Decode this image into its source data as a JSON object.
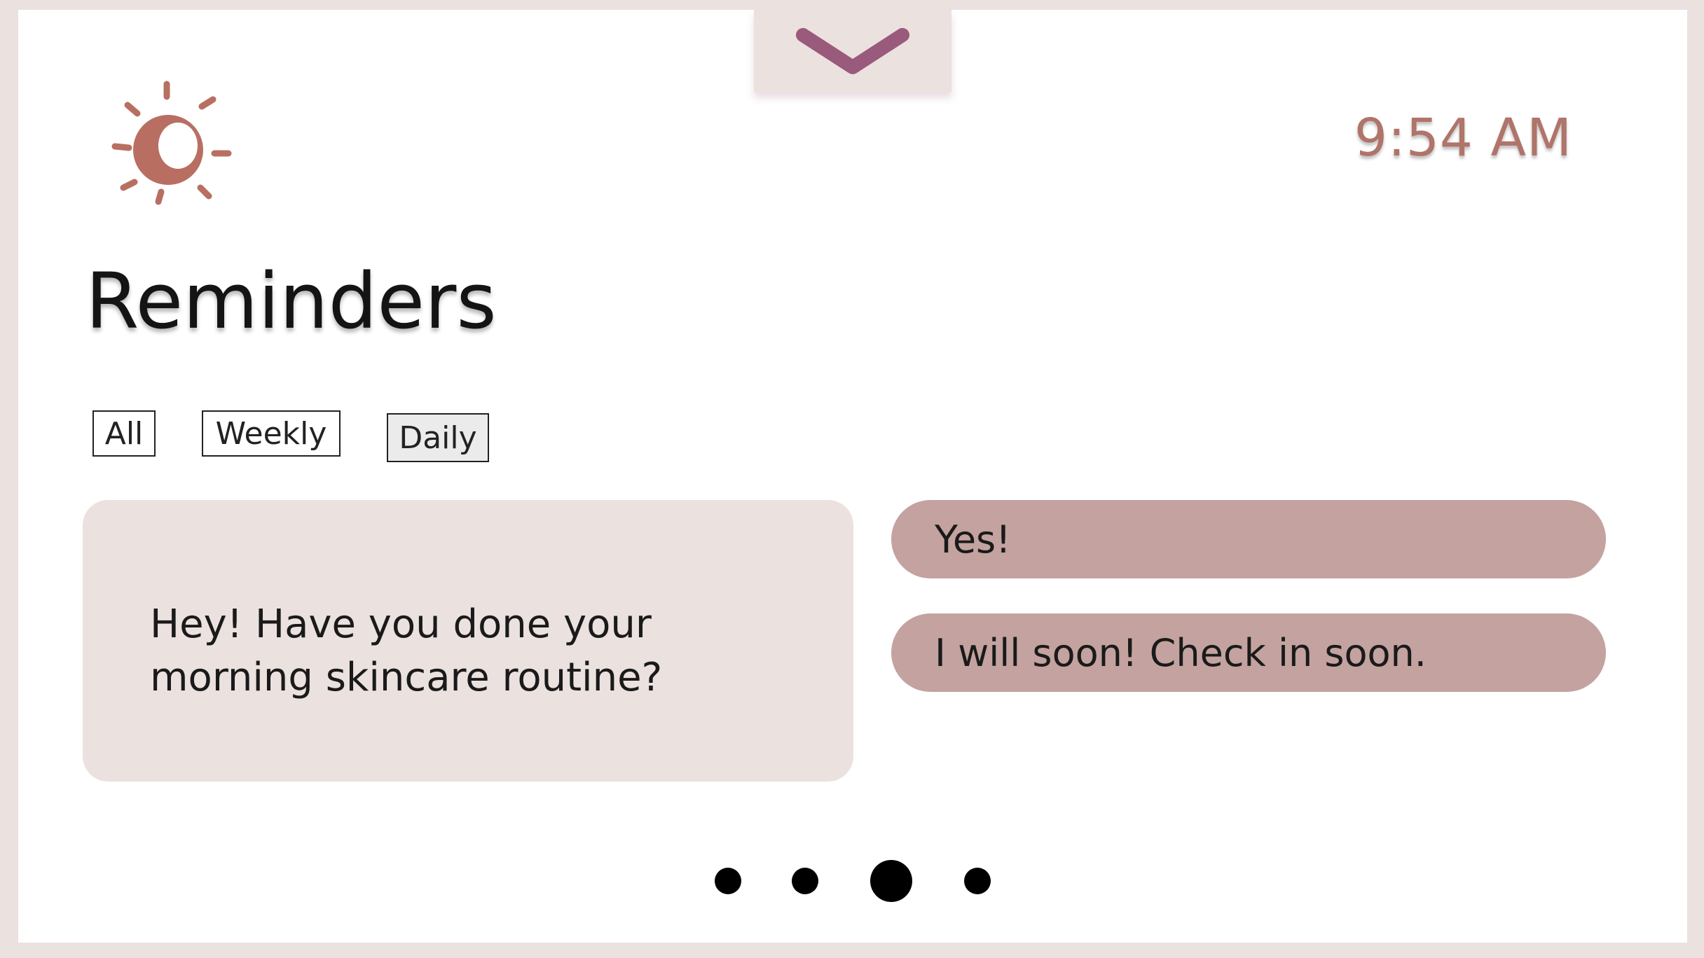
{
  "header": {
    "time": "9:54 AM",
    "weather_icon": "sun-icon",
    "pull_down_icon": "chevron-down-icon"
  },
  "page": {
    "title": "Reminders"
  },
  "filters": {
    "items": [
      {
        "label": "All",
        "selected": false
      },
      {
        "label": "Weekly",
        "selected": false
      },
      {
        "label": "Daily",
        "selected": true
      }
    ]
  },
  "reminder": {
    "message": "Hey! Have you done your morning skincare routine?"
  },
  "replies": [
    {
      "label": "Yes!"
    },
    {
      "label": "I will soon! Check in soon."
    }
  ],
  "pagination": {
    "total": 4,
    "current": 3
  },
  "colors": {
    "background": "#ebe1df",
    "accent_clock": "#b0746a",
    "sun": "#b86f62",
    "reply_button": "#c3a29f",
    "chevron": "#9a5a7c"
  }
}
